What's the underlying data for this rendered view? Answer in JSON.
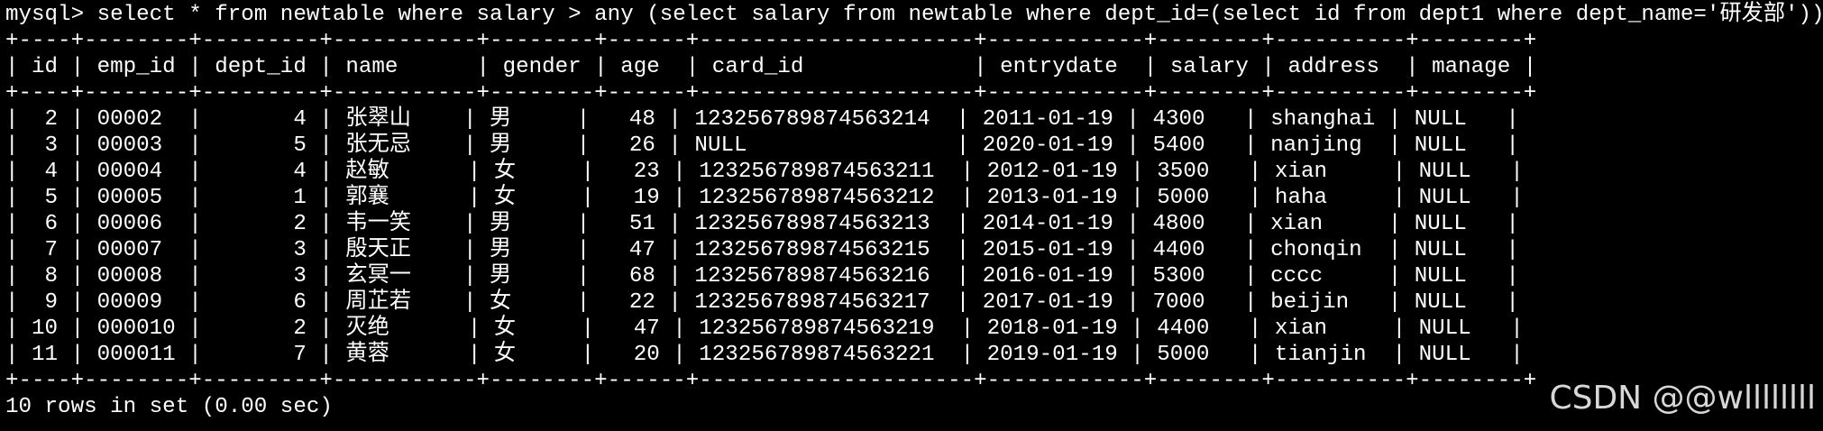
{
  "terminal": {
    "query_line": "mysql> select * from newtable where salary > any (select salary from newtable where dept_id=(select id from dept1 where dept_name='研发部'));",
    "border_line": "+----+--------+---------+-----------+--------+------+---------------------+------------+--------+----------+--------+",
    "header_line": "| id | emp_id | dept_id | name      | gender | age  | card_id             | entrydate  | salary | address  | manage |",
    "rows": [
      "|  2 | 00002  |       4 | 张翠山    | 男     |   48 | 123256789874563214  | 2011-01-19 | 4300   | shanghai | NULL   |",
      "|  3 | 00003  |       5 | 张无忌    | 男     |   26 | NULL                | 2020-01-19 | 5400   | nanjing  | NULL   |",
      "|  4 | 00004  |       4 | 赵敏      | 女     |   23 | 123256789874563211  | 2012-01-19 | 3500   | xian     | NULL   |",
      "|  5 | 00005  |       1 | 郭襄      | 女     |   19 | 123256789874563212  | 2013-01-19 | 5000   | haha     | NULL   |",
      "|  6 | 00006  |       2 | 韦一笑    | 男     |   51 | 123256789874563213  | 2014-01-19 | 4800   | xian     | NULL   |",
      "|  7 | 00007  |       3 | 殷天正    | 男     |   47 | 123256789874563215  | 2015-01-19 | 4400   | chonqin  | NULL   |",
      "|  8 | 00008  |       3 | 玄冥一    | 男     |   68 | 123256789874563216  | 2016-01-19 | 5300   | cccc     | NULL   |",
      "|  9 | 00009  |       6 | 周芷若    | 女     |   22 | 123256789874563217  | 2017-01-19 | 7000   | beijin   | NULL   |",
      "| 10 | 000010 |       2 | 灭绝      | 女     |   47 | 123256789874563219  | 2018-01-19 | 4400   | xian     | NULL   |",
      "| 11 | 000011 |       7 | 黄蓉      | 女     |   20 | 123256789874563221  | 2019-01-19 | 5000   | tianjin  | NULL   |"
    ],
    "result_line": "10 rows in set (0.00 sec)"
  },
  "watermark": {
    "text": "CSDN @@wllllllll"
  },
  "colors": {
    "background": "#000000",
    "text": "#ffffff",
    "watermark": "#d7d7d7"
  }
}
